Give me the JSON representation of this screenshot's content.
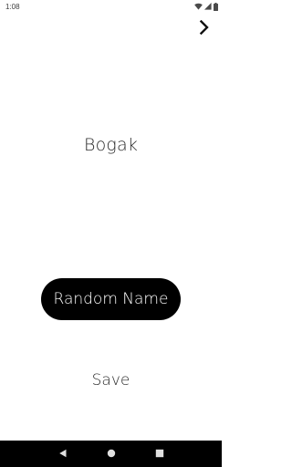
{
  "status_bar": {
    "time": "1:08",
    "icons": [
      "wifi-icon",
      "signal-icon",
      "battery-icon"
    ]
  },
  "toolbar": {
    "next_icon": "chevron-right-icon"
  },
  "main": {
    "generated_name": "Bogak",
    "random_button_label": "Random Name",
    "save_label": "Save"
  },
  "nav_bar": {
    "icons": [
      "back-icon",
      "home-icon",
      "recents-icon"
    ]
  },
  "colors": {
    "background": "#ffffff",
    "button_background": "#000000",
    "button_text": "#ffffff",
    "text": "#2a2a2a",
    "nav_bar": "#000000"
  }
}
